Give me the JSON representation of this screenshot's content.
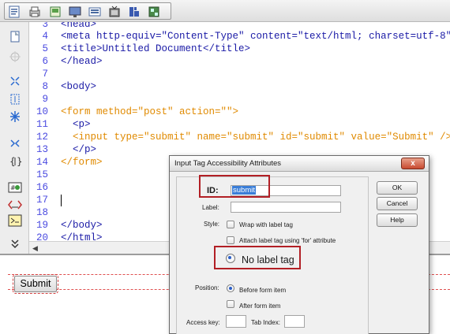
{
  "toolbar": {
    "icons": [
      "document-icon",
      "print-icon",
      "table-icon",
      "monitor-icon",
      "image-icon",
      "media-icon",
      "grid-icon",
      "template-icon"
    ]
  },
  "gutter": {
    "icons": [
      "open-document-icon",
      "collapse-icon",
      "expand-tag-icon",
      "select-parent-icon",
      "balance-icon",
      "wrap-icon",
      "format-icon",
      "comment-icon",
      "snippet-icon",
      "indent-icon",
      "outdent-icon",
      "more-icon"
    ]
  },
  "code": {
    "lines": [
      {
        "num": "3",
        "text": "<head>",
        "kind": "tag"
      },
      {
        "num": "4",
        "text": "<meta http-equiv=\"Content-Type\" content=\"text/html; charset=utf-8\" />",
        "kind": "tag"
      },
      {
        "num": "5",
        "text": "<title>Untitled Document</title>",
        "kind": "tag"
      },
      {
        "num": "6",
        "text": "</head>",
        "kind": "tag"
      },
      {
        "num": "7",
        "text": "",
        "kind": "tag"
      },
      {
        "num": "8",
        "text": "<body>",
        "kind": "tag"
      },
      {
        "num": "9",
        "text": "",
        "kind": "tag"
      },
      {
        "num": "10",
        "text": "<form method=\"post\" action=\"\">",
        "kind": "form"
      },
      {
        "num": "11",
        "text": "  <p>",
        "kind": "tag"
      },
      {
        "num": "12",
        "text": "  <input type=\"submit\" name=\"submit\" id=\"submit\" value=\"Submit\" />",
        "kind": "form"
      },
      {
        "num": "13",
        "text": "  </p>",
        "kind": "tag"
      },
      {
        "num": "14",
        "text": "</form>",
        "kind": "form"
      },
      {
        "num": "15",
        "text": "",
        "kind": "tag"
      },
      {
        "num": "16",
        "text": "",
        "kind": "tag"
      },
      {
        "num": "17",
        "text": "",
        "kind": "tag"
      },
      {
        "num": "18",
        "text": "",
        "kind": "tag"
      },
      {
        "num": "19",
        "text": "</body>",
        "kind": "tag"
      },
      {
        "num": "20",
        "text": "</html>",
        "kind": "tag"
      }
    ]
  },
  "design": {
    "submit_label": "Submit"
  },
  "dialog": {
    "title": "Input Tag Accessibility Attributes",
    "close_label": "x",
    "id_label": "ID:",
    "id_value": "submit",
    "label_label": "Label:",
    "label_value": "",
    "style_label": "Style:",
    "style_options": [
      "Wrap with label tag",
      "Attach label tag using 'for' attribute",
      "No label tag"
    ],
    "position_label": "Position:",
    "position_options": [
      "Before form item",
      "After form item"
    ],
    "access_key_label": "Access key:",
    "access_key_value": "",
    "tab_index_label": "Tab Index:",
    "tab_index_value": "",
    "buttons": {
      "ok": "OK",
      "cancel": "Cancel",
      "help": "Help"
    }
  },
  "colors": {
    "tag": "#1a1aa6",
    "form": "#e08a00",
    "line_number": "#4a4ae0",
    "highlight": "#b21f25"
  }
}
